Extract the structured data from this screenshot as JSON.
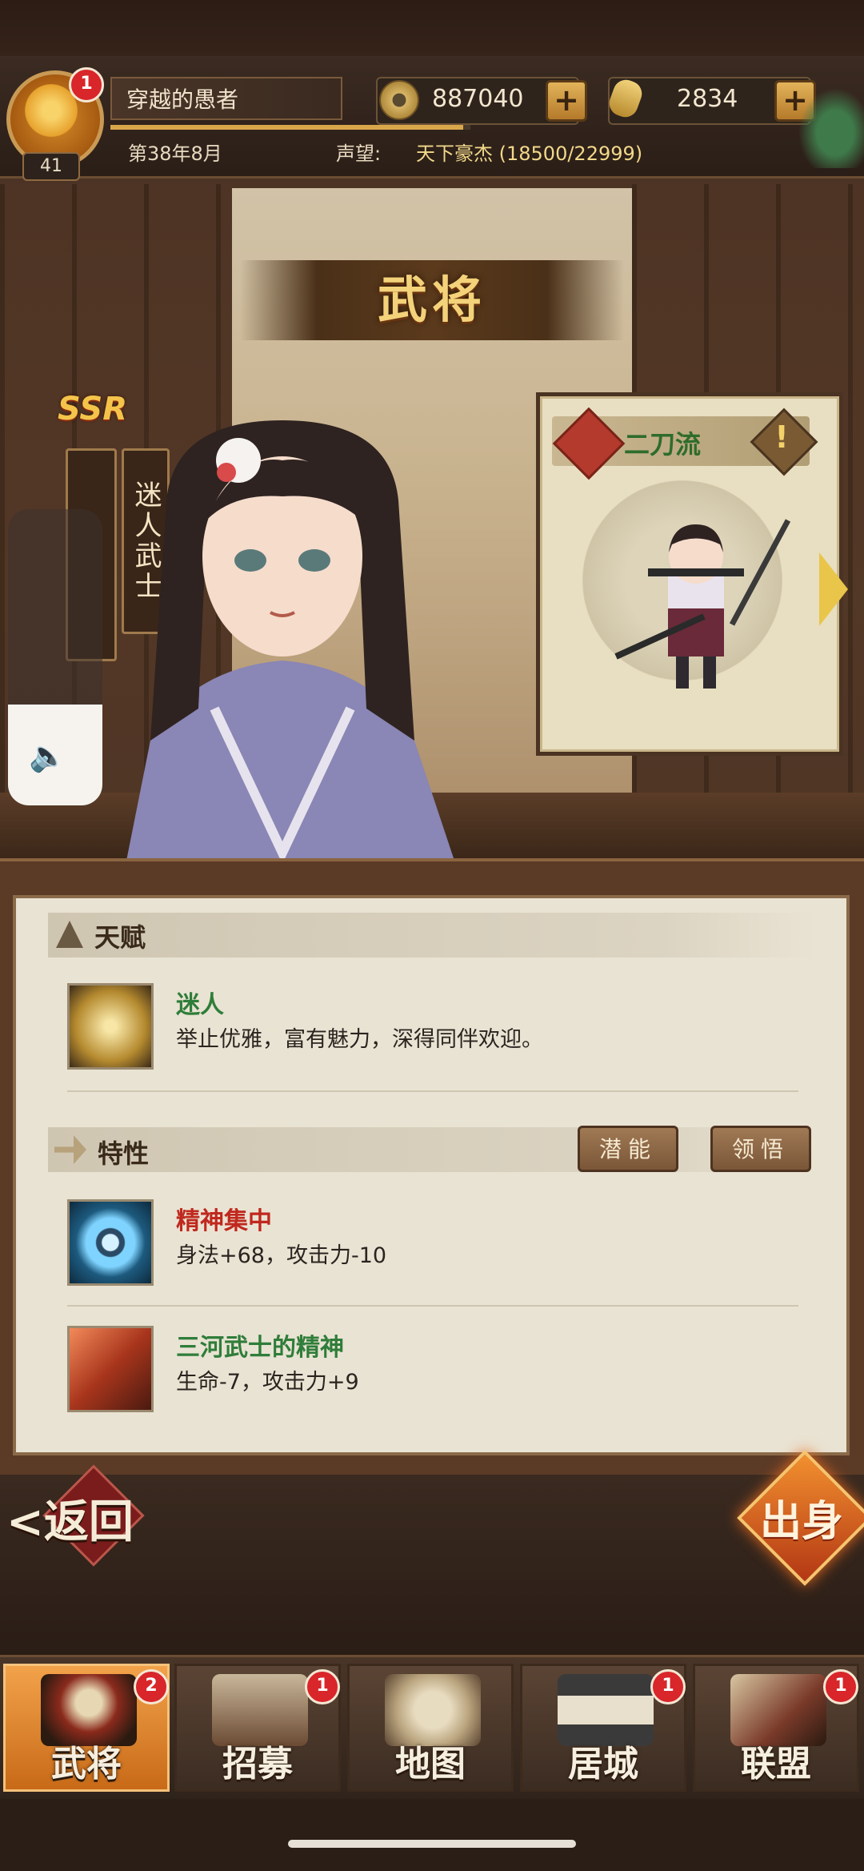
{
  "header": {
    "player_name": "穿越的愚者",
    "level": "41",
    "avatar_badge": "1",
    "date": "第38年8月",
    "prestige_label": "声望:",
    "prestige_value": "天下豪杰 (18500/22999)",
    "currency_coins": "887040",
    "currency_gold": "2834"
  },
  "title": "武将",
  "hero": {
    "rarity": "SSR",
    "title_vertical": "迷人武士"
  },
  "weapon_card": {
    "style_name": "二刀流",
    "info_icon": "!"
  },
  "talent": {
    "section_title": "天赋",
    "skill_name": "迷人",
    "skill_desc": "举止优雅，富有魅力，深得同伴欢迎。"
  },
  "traits": {
    "section_title": "特性",
    "btn_potential": "潜能",
    "btn_insight": "领悟",
    "items": [
      {
        "name": "精神集中",
        "desc": "身法+68，攻击力-10",
        "color": "#c0281e"
      },
      {
        "name": "三河武士的精神",
        "desc": "生命-7，攻击力+9",
        "color": "#2f7d3a"
      }
    ]
  },
  "actions": {
    "back": "返回",
    "origin": "出身"
  },
  "nav": {
    "tabs": [
      {
        "label": "武将",
        "badge": "2",
        "active": true
      },
      {
        "label": "招募",
        "badge": "1"
      },
      {
        "label": "地图",
        "badge": ""
      },
      {
        "label": "居城",
        "badge": "1"
      },
      {
        "label": "联盟",
        "badge": "1"
      }
    ]
  },
  "colors": {
    "accent_gold": "#f3d27a",
    "badge_red": "#d8262a",
    "talent_green": "#2f7d3a"
  }
}
